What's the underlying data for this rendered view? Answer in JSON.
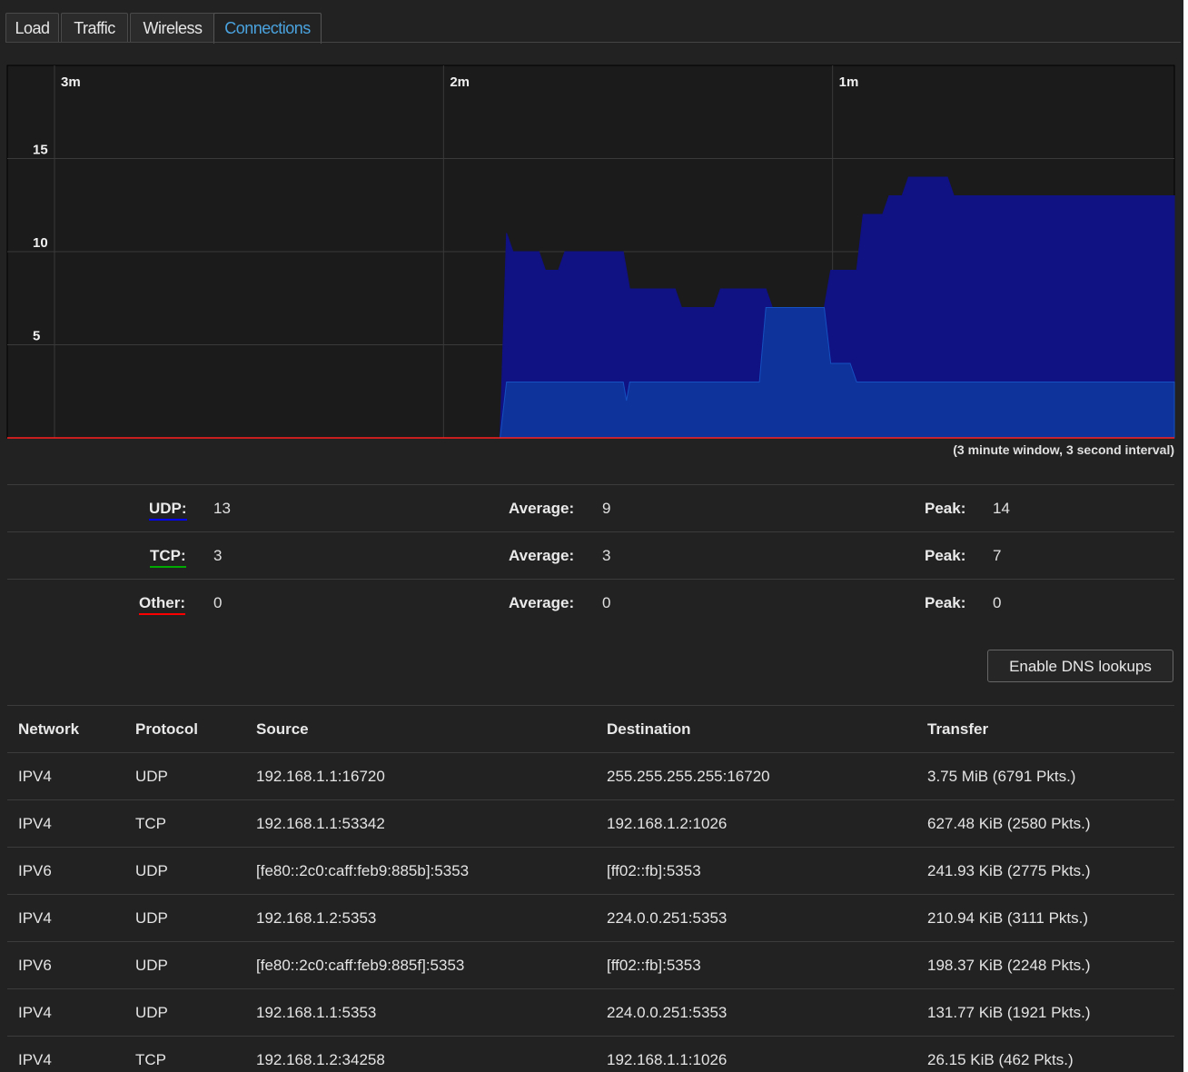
{
  "tabs": [
    {
      "label": "Load"
    },
    {
      "label": "Traffic"
    },
    {
      "label": "Wireless"
    },
    {
      "label": "Connections"
    }
  ],
  "active_tab": "Connections",
  "chart_data": {
    "type": "area",
    "title": "",
    "x_ticks": [
      "3m",
      "2m",
      "1m"
    ],
    "y_ticks": [
      15,
      10,
      5
    ],
    "ylim": [
      0,
      20
    ],
    "x_unit": "seconds ago",
    "grid": true,
    "series": [
      {
        "name": "UDP",
        "color": "#0000ff",
        "points": [
          [
            180,
            0
          ],
          [
            104,
            0
          ],
          [
            103,
            11
          ],
          [
            102,
            10
          ],
          [
            98,
            10
          ],
          [
            97,
            9
          ],
          [
            95,
            9
          ],
          [
            94,
            10
          ],
          [
            85,
            10
          ],
          [
            84,
            8
          ],
          [
            77,
            8
          ],
          [
            76,
            7
          ],
          [
            71,
            7
          ],
          [
            70,
            8
          ],
          [
            63,
            8
          ],
          [
            62,
            7
          ],
          [
            54,
            7
          ],
          [
            53,
            9
          ],
          [
            49,
            9
          ],
          [
            48,
            12
          ],
          [
            45,
            12
          ],
          [
            44,
            13
          ],
          [
            42,
            13
          ],
          [
            41,
            14
          ],
          [
            35,
            14
          ],
          [
            34,
            13
          ],
          [
            0,
            13
          ]
        ]
      },
      {
        "name": "TCP",
        "color": "#00aa00",
        "points": [
          [
            180,
            0
          ],
          [
            104,
            0
          ],
          [
            103,
            3
          ],
          [
            85,
            3
          ],
          [
            84.5,
            2
          ],
          [
            84,
            3
          ],
          [
            64,
            3
          ],
          [
            63,
            7
          ],
          [
            54,
            7
          ],
          [
            53,
            4
          ],
          [
            50,
            4
          ],
          [
            49,
            3
          ],
          [
            0,
            3
          ]
        ]
      },
      {
        "name": "Other",
        "color": "#ff0000",
        "points": [
          [
            180,
            0
          ],
          [
            0,
            0
          ]
        ]
      }
    ]
  },
  "caption": "(3 minute window, 3 second interval)",
  "stats": [
    {
      "name": "UDP:",
      "current": "13",
      "avg_label": "Average:",
      "avg": "9",
      "peak_label": "Peak:",
      "peak": "14",
      "color": "#0000ff"
    },
    {
      "name": "TCP:",
      "current": "3",
      "avg_label": "Average:",
      "avg": "3",
      "peak_label": "Peak:",
      "peak": "7",
      "color": "#00aa00"
    },
    {
      "name": "Other:",
      "current": "0",
      "avg_label": "Average:",
      "avg": "0",
      "peak_label": "Peak:",
      "peak": "0",
      "color": "#ff0000"
    }
  ],
  "dns_button": "Enable DNS lookups",
  "table": {
    "headers": [
      "Network",
      "Protocol",
      "Source",
      "Destination",
      "Transfer"
    ],
    "rows": [
      [
        "IPV4",
        "UDP",
        "192.168.1.1:16720",
        "255.255.255.255:16720",
        "3.75 MiB (6791 Pkts.)"
      ],
      [
        "IPV4",
        "TCP",
        "192.168.1.1:53342",
        "192.168.1.2:1026",
        "627.48 KiB (2580 Pkts.)"
      ],
      [
        "IPV6",
        "UDP",
        "[fe80::2c0:caff:feb9:885b]:5353",
        "[ff02::fb]:5353",
        "241.93 KiB (2775 Pkts.)"
      ],
      [
        "IPV4",
        "UDP",
        "192.168.1.2:5353",
        "224.0.0.251:5353",
        "210.94 KiB (3111 Pkts.)"
      ],
      [
        "IPV6",
        "UDP",
        "[fe80::2c0:caff:feb9:885f]:5353",
        "[ff02::fb]:5353",
        "198.37 KiB (2248 Pkts.)"
      ],
      [
        "IPV4",
        "UDP",
        "192.168.1.1:5353",
        "224.0.0.251:5353",
        "131.77 KiB (1921 Pkts.)"
      ],
      [
        "IPV4",
        "TCP",
        "192.168.1.2:34258",
        "192.168.1.1:1026",
        "26.15 KiB (462 Pkts.)"
      ]
    ]
  }
}
